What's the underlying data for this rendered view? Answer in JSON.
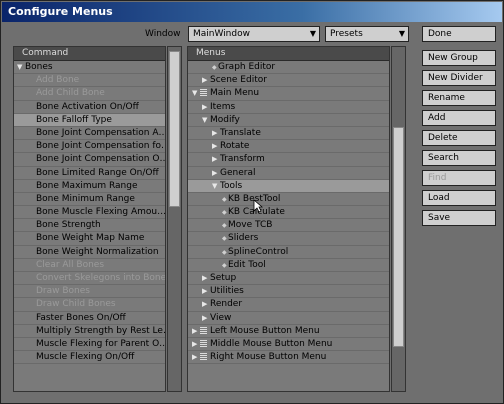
{
  "window": {
    "title": "Configure Menus",
    "window_label": "Window",
    "window_value": "MainWindow",
    "presets_value": "Presets"
  },
  "command_panel": {
    "header": "Command",
    "rows": [
      {
        "label": "Bones",
        "dim": false,
        "group": true
      },
      {
        "label": "Add Bone",
        "dim": true
      },
      {
        "label": "Add Child Bone",
        "dim": true
      },
      {
        "label": "Bone Activation On/Off",
        "dim": false
      },
      {
        "label": "Bone Falloff Type",
        "dim": false,
        "selected": true
      },
      {
        "label": "Bone Joint Compensation A…",
        "dim": false
      },
      {
        "label": "Bone Joint Compensation fo…",
        "dim": false
      },
      {
        "label": "Bone Joint Compensation O…",
        "dim": false
      },
      {
        "label": "Bone Limited Range On/Off",
        "dim": false
      },
      {
        "label": "Bone Maximum Range",
        "dim": false
      },
      {
        "label": "Bone Minimum Range",
        "dim": false
      },
      {
        "label": "Bone Muscle Flexing Amou…",
        "dim": false
      },
      {
        "label": "Bone Strength",
        "dim": false
      },
      {
        "label": "Bone Weight Map Name",
        "dim": false
      },
      {
        "label": "Bone Weight Normalization",
        "dim": false
      },
      {
        "label": "Clear All Bones",
        "dim": true
      },
      {
        "label": "Convert Skelegons into Bones…",
        "dim": true
      },
      {
        "label": "Draw Bones",
        "dim": true
      },
      {
        "label": "Draw Child Bones",
        "dim": true
      },
      {
        "label": "Faster Bones On/Off",
        "dim": false
      },
      {
        "label": "Multiply Strength by Rest Le…",
        "dim": false
      },
      {
        "label": "Muscle Flexing for Parent O…",
        "dim": false
      },
      {
        "label": "Muscle Flexing On/Off",
        "dim": false
      }
    ]
  },
  "menus_panel": {
    "header": "Menus",
    "rows": [
      {
        "label": "Graph Editor",
        "indent": 2,
        "marker": "bullet"
      },
      {
        "label": "Scene Editor",
        "indent": 1,
        "marker": "right"
      },
      {
        "label": "Main Menu",
        "indent": 0,
        "marker": "down-menu"
      },
      {
        "label": "Items",
        "indent": 1,
        "marker": "right"
      },
      {
        "label": "Modify",
        "indent": 1,
        "marker": "down"
      },
      {
        "label": "Translate",
        "indent": 2,
        "marker": "right"
      },
      {
        "label": "Rotate",
        "indent": 2,
        "marker": "right"
      },
      {
        "label": "Transform",
        "indent": 2,
        "marker": "right"
      },
      {
        "label": "General",
        "indent": 2,
        "marker": "right"
      },
      {
        "label": "Tools",
        "indent": 2,
        "marker": "down",
        "selected": true
      },
      {
        "label": "KB BestTool",
        "indent": 3,
        "marker": "bullet"
      },
      {
        "label": "KB Calculate",
        "indent": 3,
        "marker": "bullet"
      },
      {
        "label": "Move TCB",
        "indent": 3,
        "marker": "bullet"
      },
      {
        "label": "Sliders",
        "indent": 3,
        "marker": "bullet"
      },
      {
        "label": "SplineControl",
        "indent": 3,
        "marker": "bullet"
      },
      {
        "label": "Edit Tool",
        "indent": 3,
        "marker": "bullet"
      },
      {
        "label": "Setup",
        "indent": 1,
        "marker": "right"
      },
      {
        "label": "Utilities",
        "indent": 1,
        "marker": "right"
      },
      {
        "label": "Render",
        "indent": 1,
        "marker": "right"
      },
      {
        "label": "View",
        "indent": 1,
        "marker": "right"
      },
      {
        "label": "Left Mouse Button Menu",
        "indent": 0,
        "marker": "right-menu"
      },
      {
        "label": "Middle Mouse Button Menu",
        "indent": 0,
        "marker": "right-menu"
      },
      {
        "label": "Right Mouse Button Menu",
        "indent": 0,
        "marker": "right-menu"
      }
    ]
  },
  "buttons": [
    {
      "label": "Done",
      "disabled": false
    },
    {
      "label": "New Group",
      "disabled": false
    },
    {
      "label": "New Divider",
      "disabled": false
    },
    {
      "label": "Rename",
      "disabled": false
    },
    {
      "label": "Add",
      "disabled": false
    },
    {
      "label": "Delete",
      "disabled": false
    },
    {
      "label": "Search",
      "disabled": false
    },
    {
      "label": "Find",
      "disabled": true
    },
    {
      "label": "Load",
      "disabled": false
    },
    {
      "label": "Save",
      "disabled": false
    }
  ]
}
